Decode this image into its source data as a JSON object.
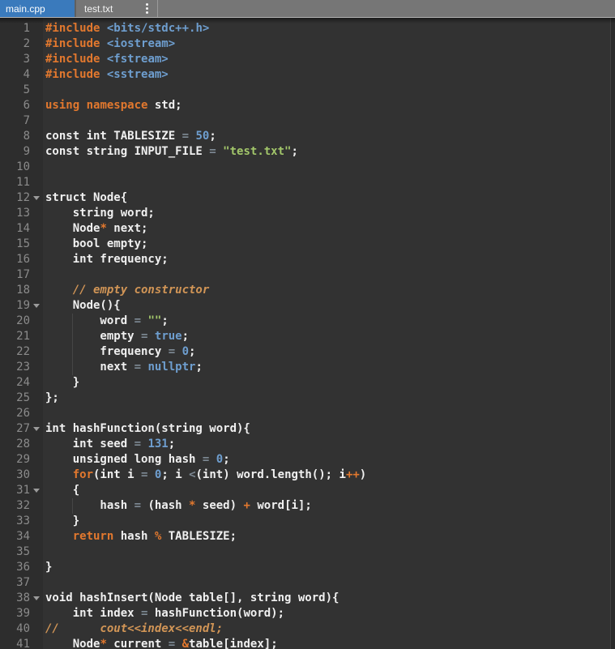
{
  "tab_bar": {
    "tabs": [
      {
        "label": "main.cpp",
        "active": true
      },
      {
        "label": "test.txt",
        "active": false
      }
    ],
    "menu_icon": "vertical-dots-icon"
  },
  "palette": {
    "active_tab_blue": "#3a7abc",
    "tab_bar_gray": "#767676",
    "editor_background": "#323232",
    "gutter_background": "#2d2d2d",
    "keyword_orange": "#e2782e",
    "comment_orange": "#d19556",
    "number_blue": "#6e9ecf",
    "string_green": "#a2c66a",
    "operator_gray": "#7e8a95",
    "plain_text": "#f0f0f0",
    "line_number_gray": "#8b8b8b"
  },
  "editor": {
    "language": "cpp",
    "lines": [
      {
        "num": "1",
        "fold": false,
        "guide": false,
        "tokens": [
          [
            "kw",
            "#include"
          ],
          [
            "pln",
            " "
          ],
          [
            "hdr",
            "<bits/stdc++.h>"
          ]
        ]
      },
      {
        "num": "2",
        "fold": false,
        "guide": false,
        "tokens": [
          [
            "kw",
            "#include"
          ],
          [
            "pln",
            " "
          ],
          [
            "hdr",
            "<iostream>"
          ]
        ]
      },
      {
        "num": "3",
        "fold": false,
        "guide": false,
        "tokens": [
          [
            "kw",
            "#include"
          ],
          [
            "pln",
            " "
          ],
          [
            "hdr",
            "<fstream>"
          ]
        ]
      },
      {
        "num": "4",
        "fold": false,
        "guide": false,
        "tokens": [
          [
            "kw",
            "#include"
          ],
          [
            "pln",
            " "
          ],
          [
            "hdr",
            "<sstream>"
          ]
        ]
      },
      {
        "num": "5",
        "fold": false,
        "guide": false,
        "tokens": []
      },
      {
        "num": "6",
        "fold": false,
        "guide": false,
        "tokens": [
          [
            "kw",
            "using"
          ],
          [
            "pln",
            " "
          ],
          [
            "kw",
            "namespace"
          ],
          [
            "pln",
            " std;"
          ]
        ]
      },
      {
        "num": "7",
        "fold": false,
        "guide": false,
        "tokens": []
      },
      {
        "num": "8",
        "fold": false,
        "guide": false,
        "tokens": [
          [
            "pln",
            "const int TABLESIZE "
          ],
          [
            "op",
            "="
          ],
          [
            "pln",
            " "
          ],
          [
            "num",
            "50"
          ],
          [
            "pln",
            ";"
          ]
        ]
      },
      {
        "num": "9",
        "fold": false,
        "guide": false,
        "tokens": [
          [
            "pln",
            "const string INPUT_FILE "
          ],
          [
            "op",
            "="
          ],
          [
            "pln",
            " "
          ],
          [
            "str",
            "\"test.txt\""
          ],
          [
            "pln",
            ";"
          ]
        ]
      },
      {
        "num": "10",
        "fold": false,
        "guide": false,
        "tokens": []
      },
      {
        "num": "11",
        "fold": false,
        "guide": false,
        "tokens": []
      },
      {
        "num": "12",
        "fold": true,
        "guide": false,
        "tokens": [
          [
            "pln",
            "struct Node{"
          ]
        ]
      },
      {
        "num": "13",
        "fold": false,
        "guide": false,
        "tokens": [
          [
            "pln",
            "    string word;"
          ]
        ]
      },
      {
        "num": "14",
        "fold": false,
        "guide": false,
        "tokens": [
          [
            "pln",
            "    Node"
          ],
          [
            "kw",
            "*"
          ],
          [
            "pln",
            " next;"
          ]
        ]
      },
      {
        "num": "15",
        "fold": false,
        "guide": false,
        "tokens": [
          [
            "pln",
            "    bool empty;"
          ]
        ]
      },
      {
        "num": "16",
        "fold": false,
        "guide": false,
        "tokens": [
          [
            "pln",
            "    int frequency;"
          ]
        ]
      },
      {
        "num": "17",
        "fold": false,
        "guide": false,
        "tokens": []
      },
      {
        "num": "18",
        "fold": false,
        "guide": false,
        "tokens": [
          [
            "com",
            "    // empty constructor"
          ]
        ]
      },
      {
        "num": "19",
        "fold": true,
        "guide": false,
        "tokens": [
          [
            "pln",
            "    Node(){"
          ]
        ]
      },
      {
        "num": "20",
        "fold": false,
        "guide": true,
        "tokens": [
          [
            "pln",
            "        word "
          ],
          [
            "op",
            "="
          ],
          [
            "pln",
            " "
          ],
          [
            "str",
            "\"\""
          ],
          [
            "pln",
            ";"
          ]
        ]
      },
      {
        "num": "21",
        "fold": false,
        "guide": true,
        "tokens": [
          [
            "pln",
            "        empty "
          ],
          [
            "op",
            "="
          ],
          [
            "pln",
            " "
          ],
          [
            "num",
            "true"
          ],
          [
            "pln",
            ";"
          ]
        ]
      },
      {
        "num": "22",
        "fold": false,
        "guide": true,
        "tokens": [
          [
            "pln",
            "        frequency "
          ],
          [
            "op",
            "="
          ],
          [
            "pln",
            " "
          ],
          [
            "num",
            "0"
          ],
          [
            "pln",
            ";"
          ]
        ]
      },
      {
        "num": "23",
        "fold": false,
        "guide": true,
        "tokens": [
          [
            "pln",
            "        next "
          ],
          [
            "op",
            "="
          ],
          [
            "pln",
            " "
          ],
          [
            "num",
            "nullptr"
          ],
          [
            "pln",
            ";"
          ]
        ]
      },
      {
        "num": "24",
        "fold": false,
        "guide": false,
        "tokens": [
          [
            "pln",
            "    }"
          ]
        ]
      },
      {
        "num": "25",
        "fold": false,
        "guide": false,
        "tokens": [
          [
            "pln",
            "};"
          ]
        ]
      },
      {
        "num": "26",
        "fold": false,
        "guide": false,
        "tokens": []
      },
      {
        "num": "27",
        "fold": true,
        "guide": false,
        "tokens": [
          [
            "pln",
            "int hashFunction(string word){"
          ]
        ]
      },
      {
        "num": "28",
        "fold": false,
        "guide": false,
        "tokens": [
          [
            "pln",
            "    int seed "
          ],
          [
            "op",
            "="
          ],
          [
            "pln",
            " "
          ],
          [
            "num",
            "131"
          ],
          [
            "pln",
            ";"
          ]
        ]
      },
      {
        "num": "29",
        "fold": false,
        "guide": false,
        "tokens": [
          [
            "pln",
            "    unsigned long hash "
          ],
          [
            "op",
            "="
          ],
          [
            "pln",
            " "
          ],
          [
            "num",
            "0"
          ],
          [
            "pln",
            ";"
          ]
        ]
      },
      {
        "num": "30",
        "fold": false,
        "guide": false,
        "tokens": [
          [
            "pln",
            "    "
          ],
          [
            "kw",
            "for"
          ],
          [
            "pln",
            "(int i "
          ],
          [
            "op",
            "="
          ],
          [
            "pln",
            " "
          ],
          [
            "num",
            "0"
          ],
          [
            "pln",
            "; i "
          ],
          [
            "op",
            "<"
          ],
          [
            "pln",
            "(int) word.length(); i"
          ],
          [
            "kw",
            "++"
          ],
          [
            "pln",
            ")"
          ]
        ]
      },
      {
        "num": "31",
        "fold": true,
        "guide": false,
        "tokens": [
          [
            "pln",
            "    {"
          ]
        ]
      },
      {
        "num": "32",
        "fold": false,
        "guide": true,
        "tokens": [
          [
            "pln",
            "        hash "
          ],
          [
            "op",
            "="
          ],
          [
            "pln",
            " (hash "
          ],
          [
            "kw",
            "*"
          ],
          [
            "pln",
            " seed) "
          ],
          [
            "kw",
            "+"
          ],
          [
            "pln",
            " word[i];"
          ]
        ]
      },
      {
        "num": "33",
        "fold": false,
        "guide": false,
        "tokens": [
          [
            "pln",
            "    }"
          ]
        ]
      },
      {
        "num": "34",
        "fold": false,
        "guide": false,
        "tokens": [
          [
            "pln",
            "    "
          ],
          [
            "kw",
            "return"
          ],
          [
            "pln",
            " hash "
          ],
          [
            "kw",
            "%"
          ],
          [
            "pln",
            " TABLESIZE;"
          ]
        ]
      },
      {
        "num": "35",
        "fold": false,
        "guide": false,
        "tokens": []
      },
      {
        "num": "36",
        "fold": false,
        "guide": false,
        "tokens": [
          [
            "pln",
            "}"
          ]
        ]
      },
      {
        "num": "37",
        "fold": false,
        "guide": false,
        "tokens": []
      },
      {
        "num": "38",
        "fold": true,
        "guide": false,
        "tokens": [
          [
            "pln",
            "void hashInsert(Node table[], string word){"
          ]
        ]
      },
      {
        "num": "39",
        "fold": false,
        "guide": false,
        "tokens": [
          [
            "pln",
            "    int index "
          ],
          [
            "op",
            "="
          ],
          [
            "pln",
            " hashFunction(word);"
          ]
        ]
      },
      {
        "num": "40",
        "fold": false,
        "guide": false,
        "tokens": [
          [
            "com",
            "//      cout<<index<<endl;"
          ]
        ]
      },
      {
        "num": "41",
        "fold": false,
        "guide": false,
        "tokens": [
          [
            "pln",
            "    Node"
          ],
          [
            "kw",
            "*"
          ],
          [
            "pln",
            " current "
          ],
          [
            "op",
            "="
          ],
          [
            "pln",
            " "
          ],
          [
            "kw",
            "&"
          ],
          [
            "pln",
            "table[index];"
          ]
        ]
      }
    ]
  }
}
